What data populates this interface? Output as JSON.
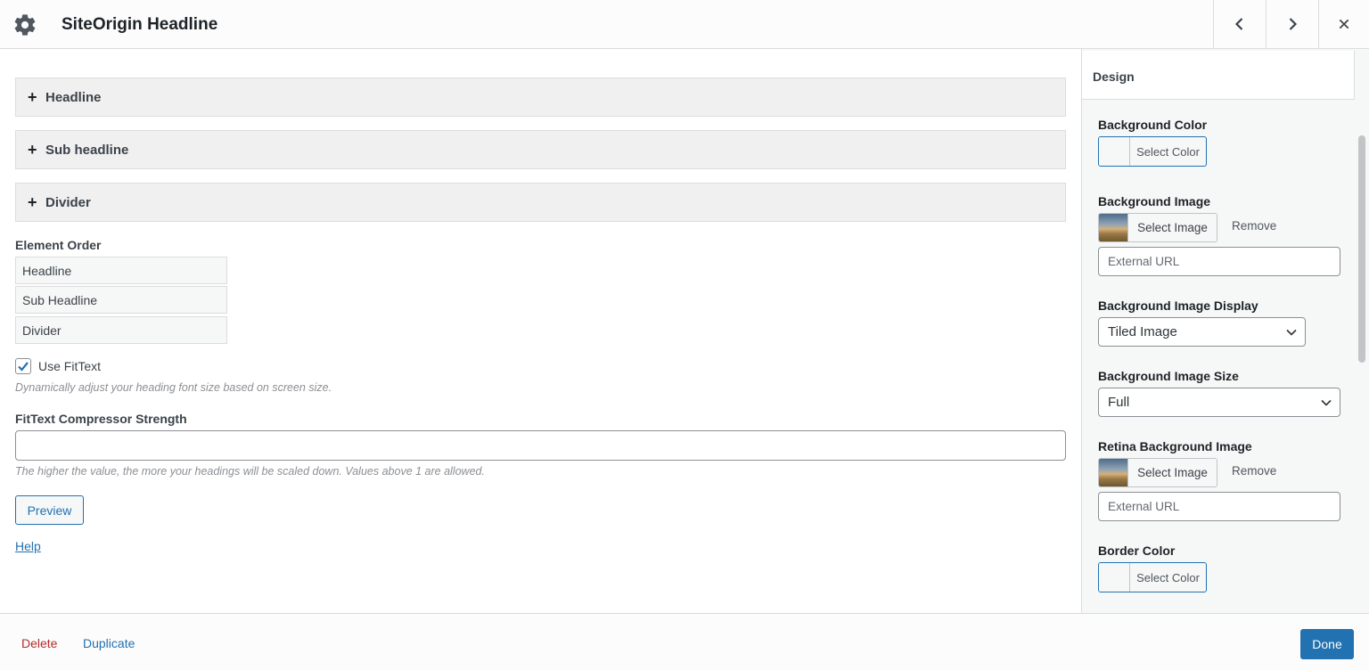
{
  "header": {
    "title": "SiteOrigin Headline",
    "icons": {
      "settings": "gear-icon",
      "prev": "chevron-left-icon",
      "next": "chevron-right-icon",
      "close": "close-icon"
    }
  },
  "main": {
    "sections": [
      {
        "label": "Headline",
        "icon": "plus-icon"
      },
      {
        "label": "Sub headline",
        "icon": "plus-icon"
      },
      {
        "label": "Divider",
        "icon": "plus-icon"
      }
    ],
    "element_order": {
      "label": "Element Order",
      "items": [
        "Headline",
        "Sub Headline",
        "Divider"
      ]
    },
    "fittext": {
      "label": "Use FitText",
      "checked": true,
      "description": "Dynamically adjust your heading font size based on screen size."
    },
    "compressor": {
      "label": "FitText Compressor Strength",
      "value": "",
      "description": "The higher the value, the more your headings will be scaled down. Values above 1 are allowed."
    },
    "preview_label": "Preview",
    "help_label": "Help"
  },
  "sidebar": {
    "title": "Design",
    "background_color": {
      "label": "Background Color",
      "button": "Select Color"
    },
    "background_image": {
      "label": "Background Image",
      "button": "Select Image",
      "remove": "Remove",
      "url_placeholder": "External URL"
    },
    "background_image_display": {
      "label": "Background Image Display",
      "value": "Tiled Image"
    },
    "background_image_size": {
      "label": "Background Image Size",
      "value": "Full"
    },
    "retina_background_image": {
      "label": "Retina Background Image",
      "button": "Select Image",
      "remove": "Remove",
      "url_placeholder": "External URL"
    },
    "border_color": {
      "label": "Border Color",
      "button": "Select Color"
    }
  },
  "footer": {
    "delete_label": "Delete",
    "duplicate_label": "Duplicate",
    "done_label": "Done"
  },
  "colors": {
    "accent": "#2271b1",
    "danger": "#b32d2e",
    "section_bg": "#f0f0f1"
  }
}
